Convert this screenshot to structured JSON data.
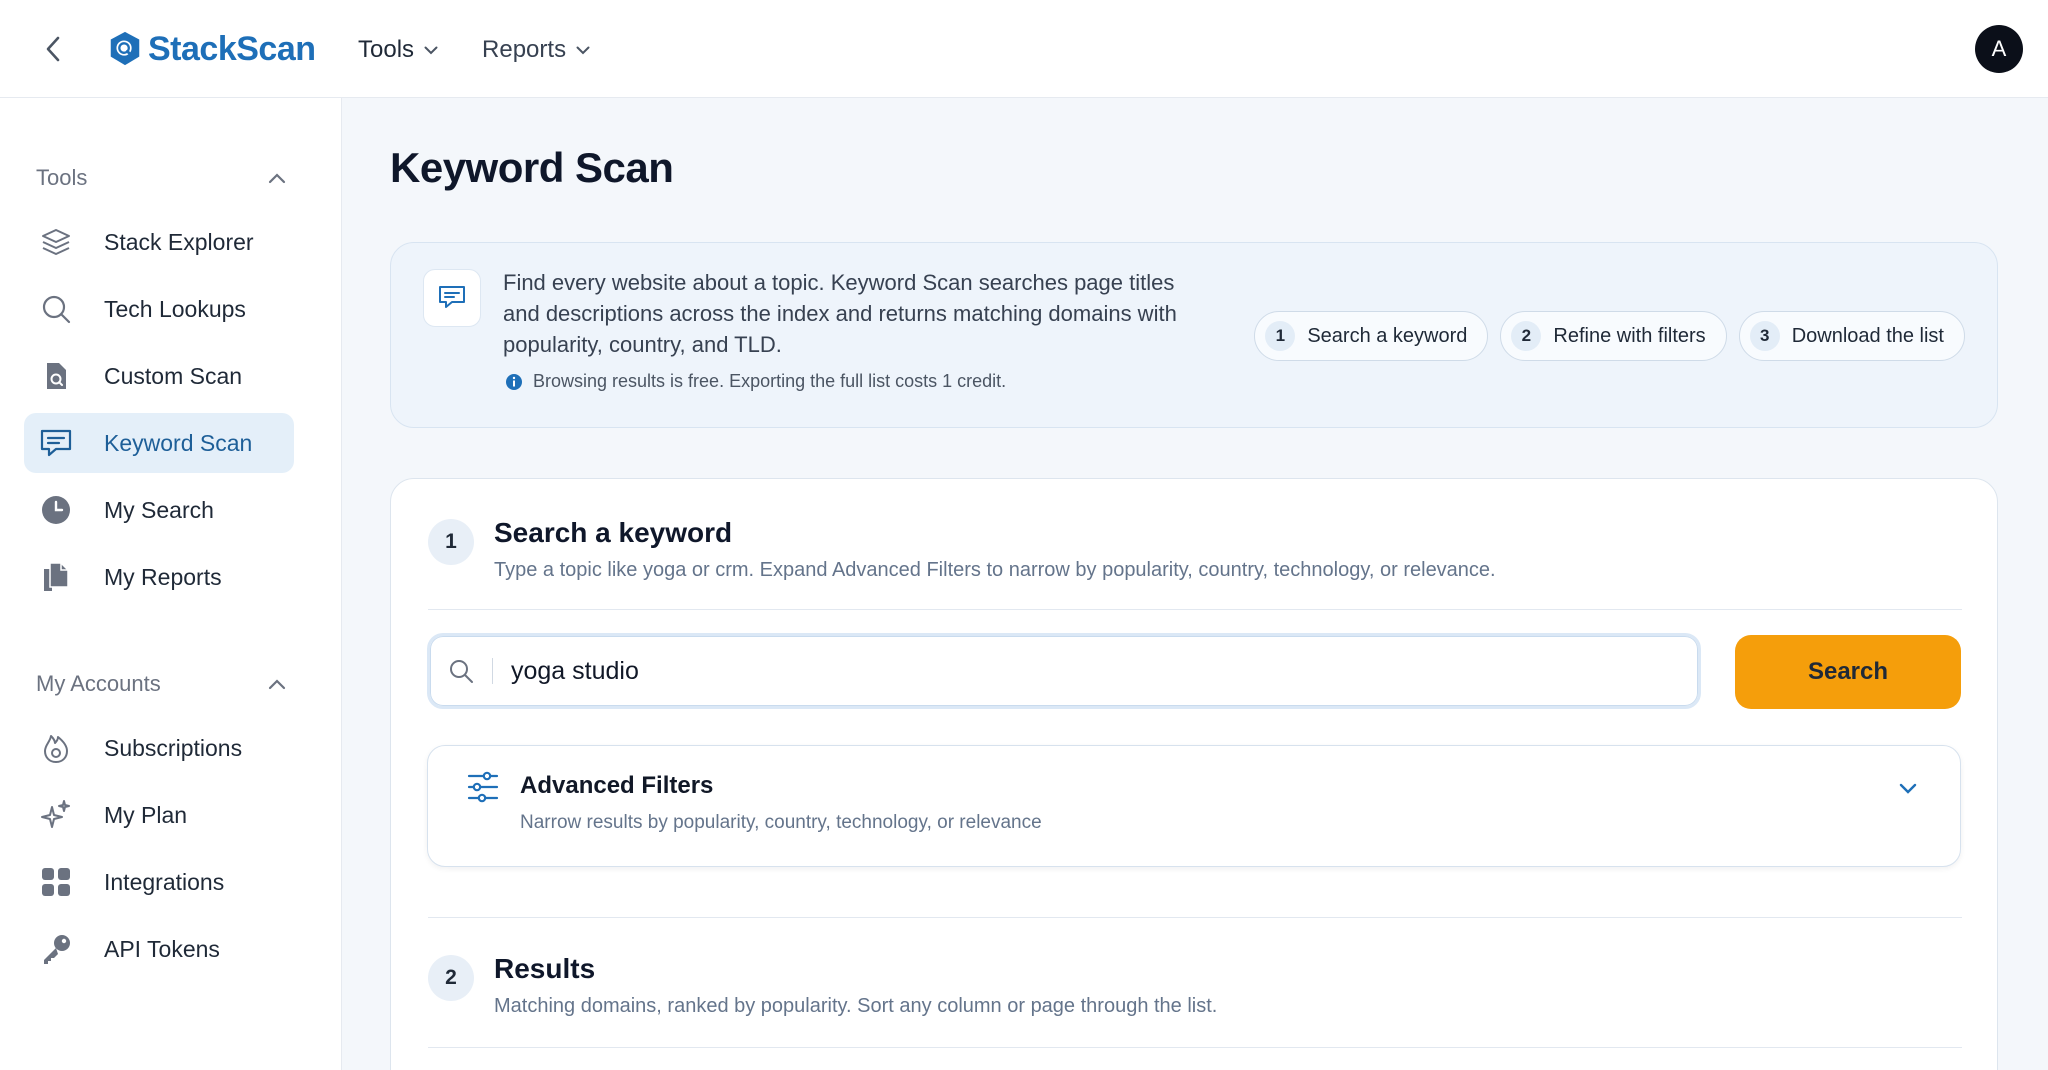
{
  "header": {
    "logo_text": "StackScan",
    "nav": [
      {
        "label": "Tools"
      },
      {
        "label": "Reports"
      }
    ],
    "avatar_initial": "A"
  },
  "sidebar": {
    "sections": [
      {
        "title": "Tools",
        "items": [
          {
            "label": "Stack Explorer",
            "icon": "layers-icon"
          },
          {
            "label": "Tech Lookups",
            "icon": "search-icon"
          },
          {
            "label": "Custom Scan",
            "icon": "file-search-icon"
          },
          {
            "label": "Keyword Scan",
            "icon": "message-icon",
            "active": true
          },
          {
            "label": "My Search",
            "icon": "clock-icon"
          },
          {
            "label": "My Reports",
            "icon": "documents-icon"
          }
        ]
      },
      {
        "title": "My Accounts",
        "items": [
          {
            "label": "Subscriptions",
            "icon": "flame-icon"
          },
          {
            "label": "My Plan",
            "icon": "sparkles-icon"
          },
          {
            "label": "Integrations",
            "icon": "grid-icon"
          },
          {
            "label": "API Tokens",
            "icon": "key-icon"
          }
        ]
      }
    ]
  },
  "page": {
    "title": "Keyword Scan",
    "info": {
      "text": "Find every website about a topic. Keyword Scan searches page titles and descriptions across the index and returns matching domains with popularity, country, and TLD.",
      "note": "Browsing results is free. Exporting the full list costs 1 credit.",
      "steps": [
        {
          "num": "1",
          "label": "Search a keyword"
        },
        {
          "num": "2",
          "label": "Refine with filters"
        },
        {
          "num": "3",
          "label": "Download the list"
        }
      ]
    },
    "search_section": {
      "num": "1",
      "title": "Search a keyword",
      "subtitle": "Type a topic like yoga or crm. Expand Advanced Filters to narrow by popularity, country, technology, or relevance.",
      "input_value": "yoga studio",
      "button_label": "Search"
    },
    "filters": {
      "title": "Advanced Filters",
      "subtitle": "Narrow results by popularity, country, technology, or relevance"
    },
    "results_section": {
      "num": "2",
      "title": "Results",
      "subtitle": "Matching domains, ranked by popularity. Sort any column or page through the list."
    }
  },
  "colors": {
    "brand": "#1e6fb8",
    "accent": "#f59e0b",
    "active_bg": "#e4eff9"
  }
}
